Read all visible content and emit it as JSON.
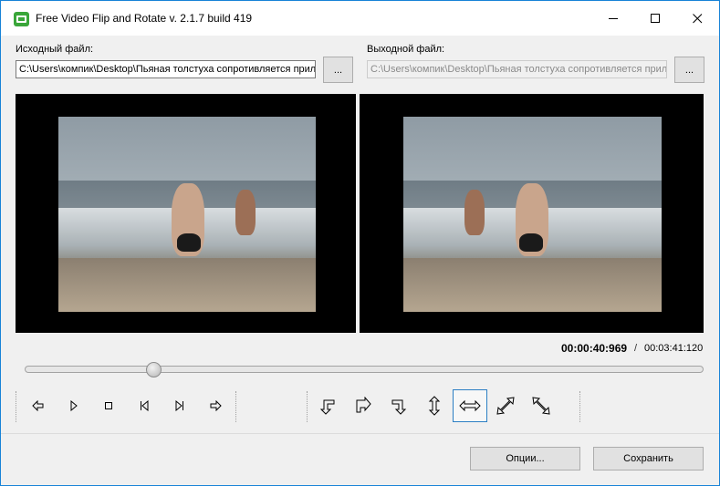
{
  "window": {
    "title": "Free Video Flip and Rotate  v. 2.1.7 build 419",
    "controls": [
      "minimize-icon",
      "maximize-icon",
      "close-icon"
    ]
  },
  "source": {
    "label": "Исходный файл:",
    "path": "C:\\Users\\компик\\Desktop\\Пьяная толстуха сопротивляется прил",
    "browse_label": "..."
  },
  "output": {
    "label": "Выходной файл:",
    "path": "C:\\Users\\компик\\Desktop\\Пьяная толстуха сопротивляется прил",
    "browse_label": "..."
  },
  "playback": {
    "current_time": "00:00:40:969",
    "separator": "/",
    "total_time": "00:03:41:120",
    "progress": 0.183
  },
  "player_controls": [
    "previous-frame-icon",
    "play-icon",
    "stop-icon",
    "skip-to-start-icon",
    "skip-to-end-icon",
    "next-frame-icon"
  ],
  "transform_controls": {
    "items": [
      "rotate-90-left-icon",
      "rotate-90-right-icon",
      "rotate-90-down-icon",
      "flip-vertical-icon",
      "flip-horizontal-icon",
      "diagonal-flip-icon",
      "anti-diagonal-flip-icon"
    ],
    "selected": "flip-horizontal-icon"
  },
  "buttons": {
    "options": "Опции...",
    "save": "Сохранить"
  },
  "colors": {
    "accent": "#2c7fc4",
    "window_border": "#1883d7",
    "app_icon": "#3aa63a"
  }
}
